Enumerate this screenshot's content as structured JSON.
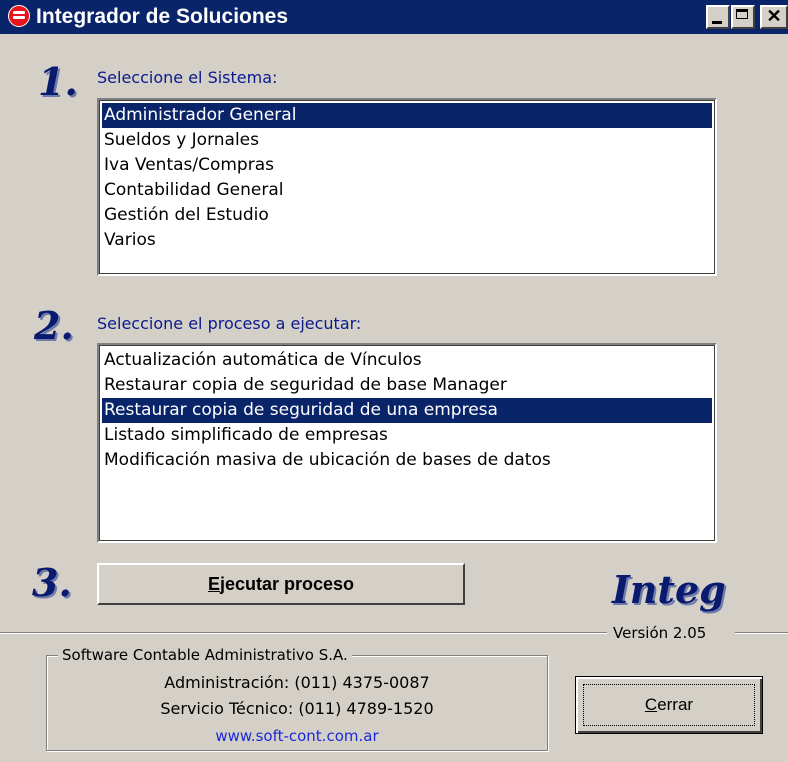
{
  "window": {
    "title": "Integrador de Soluciones",
    "icon": "app-logo-icon"
  },
  "step1": {
    "number": "1.",
    "label": "Seleccione el Sistema:",
    "items": [
      "Administrador General",
      "Sueldos y Jornales",
      "Iva Ventas/Compras",
      "Contabilidad General",
      "Gestión del Estudio",
      "Varios"
    ],
    "selected_index": 0
  },
  "step2": {
    "number": "2.",
    "label": "Seleccione el proceso a ejecutar:",
    "items": [
      "Actualización automática de Vínculos",
      "Restaurar copia de seguridad de base Manager",
      "Restaurar copia de seguridad de una empresa",
      "Listado simplificado de empresas",
      "Modificación masiva de ubicación de bases de datos"
    ],
    "selected_index": 2
  },
  "step3": {
    "number": "3.",
    "button_accel": "E",
    "button_rest": "jecutar proceso"
  },
  "brand": {
    "logo": "Integ",
    "version": "Versión 2.05"
  },
  "company": {
    "group_title": "Software Contable Administrativo S.A.",
    "admin": "Administración: (011) 4375-0087",
    "service": "Servicio Técnico: (011) 4789-1520",
    "website": "www.soft-cont.com.ar"
  },
  "close_button": {
    "accel": "C",
    "rest": "errar"
  },
  "colors": {
    "selection": "#0a246a",
    "label_blue": "#0a1a8e",
    "link_blue": "#1a2ad8",
    "face": "#d4d0c8"
  }
}
